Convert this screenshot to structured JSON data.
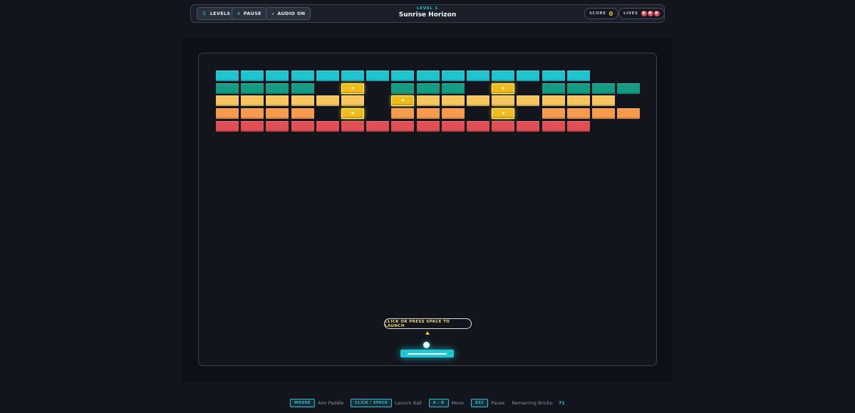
{
  "toolbar": {
    "levels_label": "LEVELS",
    "levels_icon": "menu-icon",
    "pause_label": "PAUSE",
    "pause_icon": "pause-icon",
    "audio_label": "AUDIO ON",
    "audio_icon": "speaker-icon"
  },
  "level": {
    "label": "LEVEL 1",
    "name": "Sunrise Horizon"
  },
  "score": {
    "label": "SCORE",
    "value": "0"
  },
  "lives": {
    "label": "LIVES",
    "count": 3,
    "icon": "heart-icon"
  },
  "launch_hint": "CLICK OR PRESS SPACE TO LAUNCH",
  "footer": {
    "hints": [
      {
        "key": "MOUSE",
        "desc": "Aim Paddle"
      },
      {
        "key": "CLICK / SPACE",
        "desc": "Launch Ball"
      },
      {
        "key": "A / D",
        "desc": "Move"
      },
      {
        "key": "ESC",
        "desc": "Pause"
      }
    ],
    "remaining_label": "Remaining Bricks:",
    "remaining_value": "71"
  },
  "colors": {
    "accent": "#22c7d6",
    "row_colors": [
      "#1fc4cf",
      "#159b84",
      "#f7c65e",
      "#f69b4b",
      "#e24e55"
    ],
    "star_brick": "#f0bc1c",
    "paddle": "#22c7d6",
    "score": "#f5c518"
  },
  "bricks": {
    "cols": 17,
    "rows": [
      "ccccccccccccccc..",
      "cccc.s.ccc.s.cccc",
      "cccccc.scccccccc.",
      "cccc.s.ccc.s.cccc",
      "ccccccccccccccc.."
    ],
    "legend": {
      "c": "regular brick",
      "s": "star brick",
      ".": "empty"
    }
  }
}
